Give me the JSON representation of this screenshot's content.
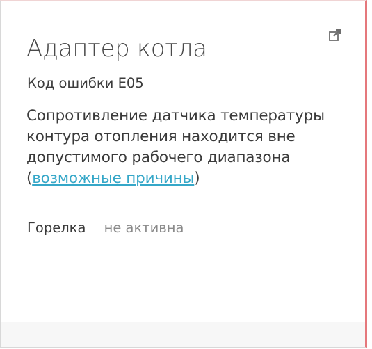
{
  "card": {
    "title": "Адаптер котла",
    "error_code": "Код ошибки E05",
    "description": {
      "line1": "Сопротивление датчика температуры",
      "line2": "контура отопления находится вне",
      "line3": "допустимого рабочего диапазона",
      "paren_open": "(",
      "link_label": "возможные причины",
      "paren_close": ")"
    },
    "status": {
      "label": "Горелка",
      "value": "не активна"
    },
    "icons": {
      "external_link": "external-link-icon"
    }
  },
  "colors": {
    "accent_border": "#e5787c",
    "link": "#35a7c8"
  }
}
